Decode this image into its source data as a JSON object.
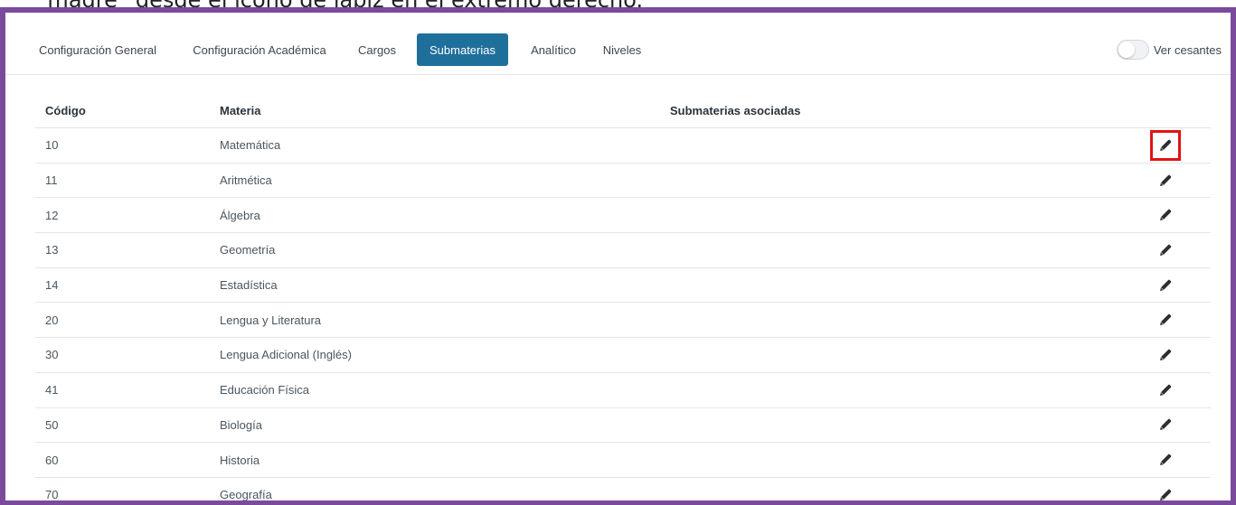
{
  "caption": "“madre” desde el ícono de lápiz en el extremo derecho.",
  "tabs": [
    {
      "label": "Configuración General",
      "active": false
    },
    {
      "label": "Configuración Académica",
      "active": false
    },
    {
      "label": "Cargos",
      "active": false
    },
    {
      "label": "Submaterias",
      "active": true
    },
    {
      "label": "Analítico",
      "active": false
    },
    {
      "label": "Niveles",
      "active": false
    }
  ],
  "toggle": {
    "label": "Ver cesantes",
    "on": false
  },
  "table": {
    "headers": {
      "code": "Código",
      "subject": "Materia",
      "subsubjects": "Submaterias asociadas"
    },
    "rows": [
      {
        "code": "10",
        "subject": "Matemática",
        "subsubjects": ""
      },
      {
        "code": "11",
        "subject": "Aritmética",
        "subsubjects": ""
      },
      {
        "code": "12",
        "subject": "Álgebra",
        "subsubjects": ""
      },
      {
        "code": "13",
        "subject": "Geometría",
        "subsubjects": ""
      },
      {
        "code": "14",
        "subject": "Estadística",
        "subsubjects": ""
      },
      {
        "code": "20",
        "subject": "Lengua y Literatura",
        "subsubjects": ""
      },
      {
        "code": "30",
        "subject": "Lengua Adicional (Inglés)",
        "subsubjects": ""
      },
      {
        "code": "41",
        "subject": "Educación Física",
        "subsubjects": ""
      },
      {
        "code": "50",
        "subject": "Biología",
        "subsubjects": ""
      },
      {
        "code": "60",
        "subject": "Historia",
        "subsubjects": ""
      },
      {
        "code": "70",
        "subject": "Geografía",
        "subsubjects": ""
      }
    ],
    "row_action_icon": "pencil-icon"
  },
  "colors": {
    "frame": "#7b4a9d",
    "active_tab": "#1f6f9b",
    "highlight": "#e01414"
  }
}
